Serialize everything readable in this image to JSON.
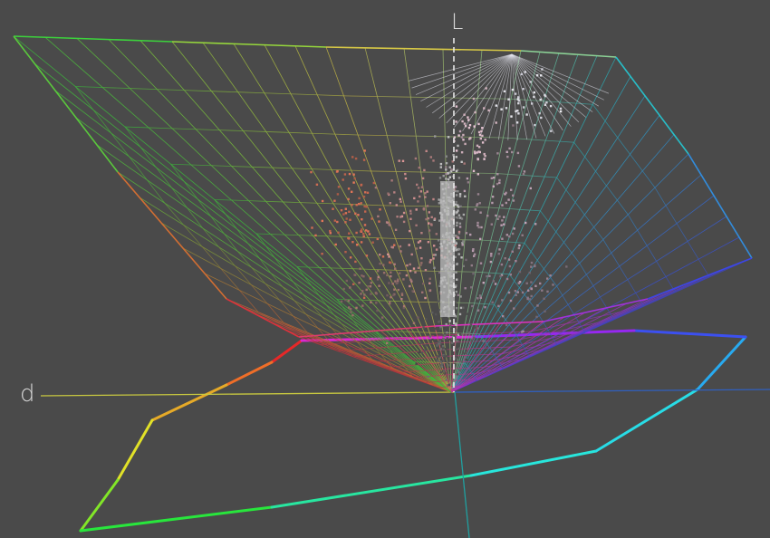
{
  "axes": {
    "vertical_label": "L",
    "horizontal_label": "d"
  },
  "colors": {
    "background": "#4a4a4a",
    "axis_lightness": "#e8e8e8",
    "axis_d": "#c8c840",
    "axis_b": "#3060c0",
    "axis_cyan": "#20a0a0"
  },
  "scene": {
    "type": "3d color gamut wireframe with scatter points and projected gamut boundary",
    "wireframe_hues": [
      "green",
      "yellow",
      "orange",
      "red",
      "magenta",
      "purple",
      "blue",
      "cyan"
    ],
    "scatter_hues": [
      "salmon",
      "pink",
      "gray",
      "white"
    ]
  }
}
